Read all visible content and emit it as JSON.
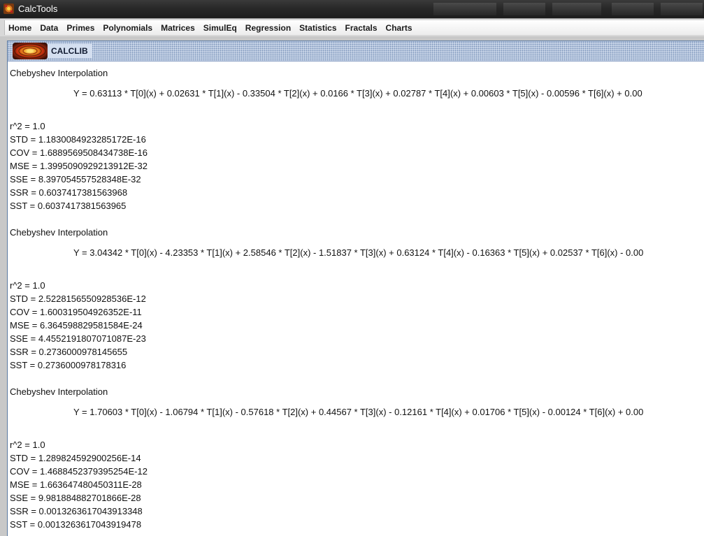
{
  "window": {
    "title": "CalcTools"
  },
  "menu": {
    "items": [
      "Home",
      "Data",
      "Primes",
      "Polynomials",
      "Matrices",
      "SimulEq",
      "Regression",
      "Statistics",
      "Fractals",
      "Charts"
    ]
  },
  "frame": {
    "title": "CALCLIB",
    "logo_icon": "calclib-fractal-logo-icon"
  },
  "results": [
    {
      "heading": "Chebyshev Interpolation",
      "equation": "Y = 0.63113 * T[0](x) + 0.02631 * T[1](x) - 0.33504 * T[2](x) + 0.0166 * T[3](x) + 0.02787 * T[4](x) + 0.00603 * T[5](x) - 0.00596 * T[6](x) + 0.00",
      "r2": "r^2 = 1.0",
      "std": "STD = 1.1830084923285172E-16",
      "cov": "COV = 1.6889569508434738E-16",
      "mse": "MSE = 1.3995090929213912E-32",
      "sse": "SSE = 8.397054557528348E-32",
      "ssr": "SSR = 0.6037417381563968",
      "sst": "SST = 0.6037417381563965"
    },
    {
      "heading": "Chebyshev Interpolation",
      "equation": "Y = 3.04342 * T[0](x) - 4.23353 * T[1](x) + 2.58546 * T[2](x) - 1.51837 * T[3](x) + 0.63124 * T[4](x) - 0.16363 * T[5](x) + 0.02537 * T[6](x) - 0.00",
      "r2": "r^2 = 1.0",
      "std": "STD = 2.5228156550928536E-12",
      "cov": "COV = 1.600319504926352E-11",
      "mse": "MSE = 6.364598829581584E-24",
      "sse": "SSE = 4.4552191807071087E-23",
      "ssr": "SSR = 0.2736000978145655",
      "sst": "SST = 0.2736000978178316"
    },
    {
      "heading": "Chebyshev Interpolation",
      "equation": "Y = 1.70603 * T[0](x) - 1.06794 * T[1](x) - 0.57618 * T[2](x) + 0.44567 * T[3](x) - 0.12161 * T[4](x) + 0.01706 * T[5](x) - 0.00124 * T[6](x) + 0.00",
      "r2": "r^2 = 1.0",
      "std": "STD = 1.289824592900256E-14",
      "cov": "COV = 1.4688452379395254E-12",
      "mse": "MSE = 1.663647480450311E-28",
      "sse": "SSE = 9.981884882701866E-28",
      "ssr": "SSR = 0.0013263617043913348",
      "sst": "SST = 0.0013263617043919478"
    }
  ]
}
